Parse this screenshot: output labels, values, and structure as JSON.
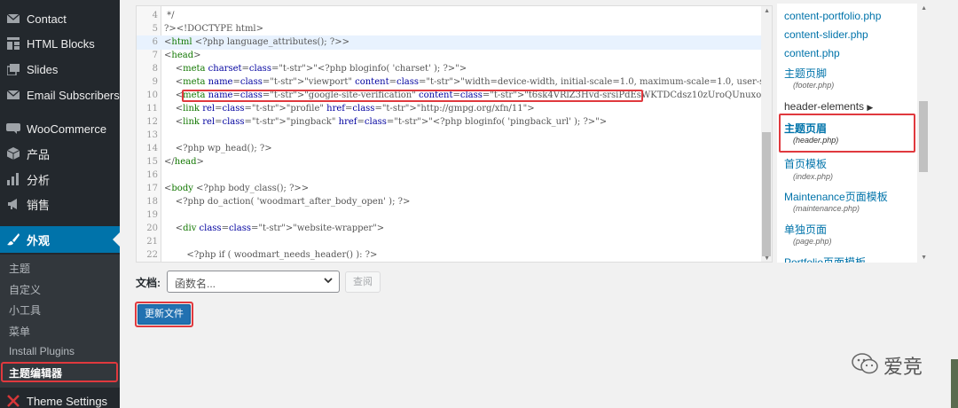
{
  "sidebar": {
    "items": [
      {
        "label": "Contact",
        "icon": "envelope-icon"
      },
      {
        "label": "HTML Blocks",
        "icon": "grid-icon"
      },
      {
        "label": "Slides",
        "icon": "slides-icon"
      },
      {
        "label": "Email Subscribers",
        "icon": "envelope-icon"
      },
      {
        "label": "WooCommerce",
        "icon": "woocommerce-icon"
      },
      {
        "label": "产品",
        "icon": "box-icon"
      },
      {
        "label": "分析",
        "icon": "bar-chart-icon"
      },
      {
        "label": "销售",
        "icon": "megaphone-icon"
      },
      {
        "label": "外观",
        "icon": "paintbrush-icon"
      },
      {
        "label": "Theme Settings",
        "icon": "theme-settings-icon"
      }
    ],
    "submenu": [
      "主题",
      "自定义",
      "小工具",
      "菜单",
      "Install Plugins",
      "主题编辑器"
    ]
  },
  "editor": {
    "lines": [
      {
        "n": "4",
        "text": " */"
      },
      {
        "n": "5",
        "text": "?><!DOCTYPE html>"
      },
      {
        "n": "6",
        "text": "<html <?php language_attributes(); ?>>"
      },
      {
        "n": "7",
        "text": "<head>"
      },
      {
        "n": "8",
        "text": "    <meta charset=\"<?php bloginfo( 'charset' ); ?>\">"
      },
      {
        "n": "9",
        "text": "    <meta name=\"viewport\" content=\"width=device-width, initial-scale=1.0, maximum-scale=1.0, user-scalable=no\">"
      },
      {
        "n": "10",
        "text": "    <meta name=\"google-site-verification\" content=\"t6sk4VRlZ3Hvd-srsiPdEsWKTDCdsz10zUroQUnuxoc\" />"
      },
      {
        "n": "11",
        "text": "    <link rel=\"profile\" href=\"http://gmpg.org/xfn/11\">"
      },
      {
        "n": "12",
        "text": "    <link rel=\"pingback\" href=\"<?php bloginfo( 'pingback_url' ); ?>\">"
      },
      {
        "n": "13",
        "text": ""
      },
      {
        "n": "14",
        "text": "    <?php wp_head(); ?>"
      },
      {
        "n": "15",
        "text": "</head>"
      },
      {
        "n": "16",
        "text": ""
      },
      {
        "n": "17",
        "text": "<body <?php body_class(); ?>>"
      },
      {
        "n": "18",
        "text": "    <?php do_action( 'woodmart_after_body_open' ); ?>"
      },
      {
        "n": "19",
        "text": ""
      },
      {
        "n": "20",
        "text": "    <div class=\"website-wrapper\">"
      },
      {
        "n": "21",
        "text": ""
      },
      {
        "n": "22",
        "text": "        <?php if ( woodmart_needs_header() ): ?>"
      }
    ]
  },
  "files": {
    "f1": "content-portfolio.php",
    "f2": "content-slider.php",
    "f3": "content.php",
    "footer_title": "主题页脚",
    "footer_file": "(footer.php)",
    "folder": "header-elements",
    "header_title": "主题页眉",
    "header_file": "(header.php)",
    "index_title": "首页模板",
    "index_file": "(index.php)",
    "maint_title": "Maintenance页面模板",
    "maint_file": "(maintenance.php)",
    "page_title": "单独页面",
    "page_file": "(page.php)",
    "portfolio_title": "Portfolio页面模板"
  },
  "doc": {
    "label": "文档:",
    "select_value": "函数名...",
    "lookup": "查阅"
  },
  "update_button": "更新文件",
  "watermark": "爱竞"
}
